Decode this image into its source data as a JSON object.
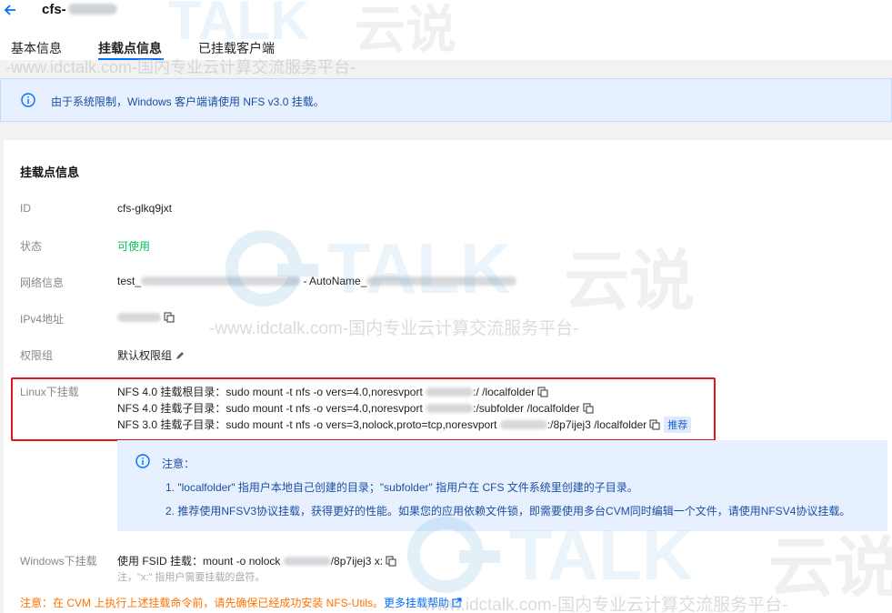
{
  "header": {
    "title_prefix": "cfs-",
    "tabs": [
      "基本信息",
      "挂载点信息",
      "已挂载客户端"
    ]
  },
  "alert": {
    "text": "由于系统限制，Windows 客户端请使用 NFS v3.0 挂载。"
  },
  "card": {
    "title": "挂载点信息",
    "id_label": "ID",
    "id_value": "cfs-glkq9jxt",
    "status_label": "状态",
    "status_value": "可使用",
    "network_label": "网络信息",
    "network_prefix": "test_",
    "network_mid": " - AutoName_",
    "ipv4_label": "IPv4地址",
    "perm_label": "权限组",
    "perm_value": "默认权限组",
    "linux_label": "Linux下挂载",
    "linux_lines": [
      {
        "prefix": "NFS 4.0 挂载根目录：sudo mount -t nfs -o vers=4.0,noresvport ",
        "suffix": ":/ /localfolder"
      },
      {
        "prefix": "NFS 4.0 挂载子目录：sudo mount -t nfs -o vers=4.0,noresvport ",
        "suffix": ":/subfolder /localfolder"
      },
      {
        "prefix": "NFS 3.0 挂载子目录：sudo mount -t nfs -o vers=3,nolock,proto=tcp,noresvport ",
        "suffix": ":/8p7ijej3 /localfolder"
      }
    ],
    "recommend_tag": "推荐",
    "note_title": "注意：",
    "note_1": "1. \"localfolder\" 指用户本地自己创建的目录；\"subfolder\" 指用户在 CFS 文件系统里创建的子目录。",
    "note_2": "2. 推荐使用NFSV3协议挂载，获得更好的性能。如果您的应用依赖文件锁，即需要使用多台CVM同时编辑一个文件，请使用NFSV4协议挂载。",
    "windows_label": "Windows下挂载",
    "windows_prefix": "使用 FSID 挂载：mount -o nolock ",
    "windows_suffix": "/8p7ijej3 x:",
    "windows_hint": "注，\"x:\" 指用户需要挂载的盘符。",
    "footer_warn": "注意：在 CVM 上执行上述挂载命令前，请先确保已经成功安装 NFS-Utils。",
    "footer_link": "更多挂载帮助"
  },
  "watermark": {
    "url_text": "-www.idctalk.com-国内专业云计算交流服务平台-",
    "brand_text": "TALK",
    "brand_cn": "云说"
  },
  "colors": {
    "accent": "#006eff",
    "ok": "#0abf5b",
    "warn": "#ff7200",
    "highlight_box": "#e4161b",
    "info_bg": "#e6f0fe"
  }
}
